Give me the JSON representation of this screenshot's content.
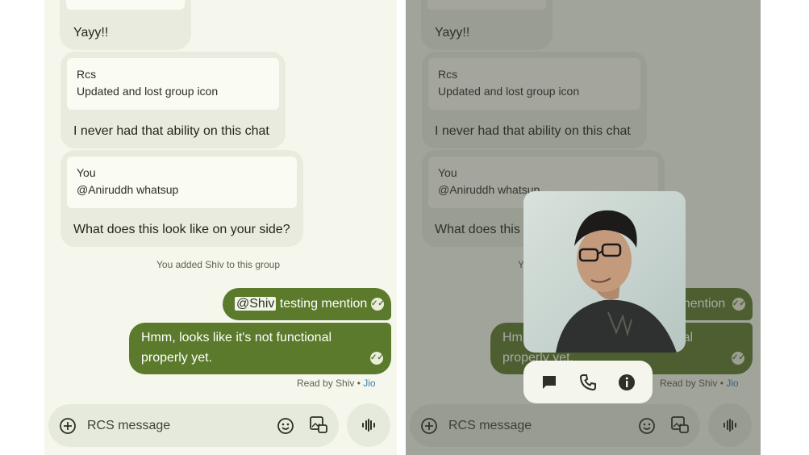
{
  "conversation": {
    "msg_yayy": "Yayy!!",
    "quote1_name": "Rcs",
    "quote1_text": "Updated and lost group icon",
    "msg_ability": "I never had that ability on this chat",
    "quote2_name": "You",
    "quote2_text": "@Aniruddh whatsup",
    "msg_side": "What does this look like on your side?",
    "system_added": "You added Shiv to this group",
    "out1_mention": "@Shiv",
    "out1_rest": " testing mention",
    "out2_line1": "Hmm, looks like it's not functional",
    "out2_line2": "properly yet.",
    "read_by": "Read by Shiv • ",
    "carrier": "Jio"
  },
  "compose": {
    "placeholder": "RCS message"
  },
  "contact_popup": {
    "actions": [
      "message-icon",
      "phone-icon",
      "info-icon"
    ]
  },
  "colors": {
    "background": "#f5f7ec",
    "incoming": "#e8ebdd",
    "outgoing": "#5b7a2b",
    "link": "#3a7ab8"
  }
}
